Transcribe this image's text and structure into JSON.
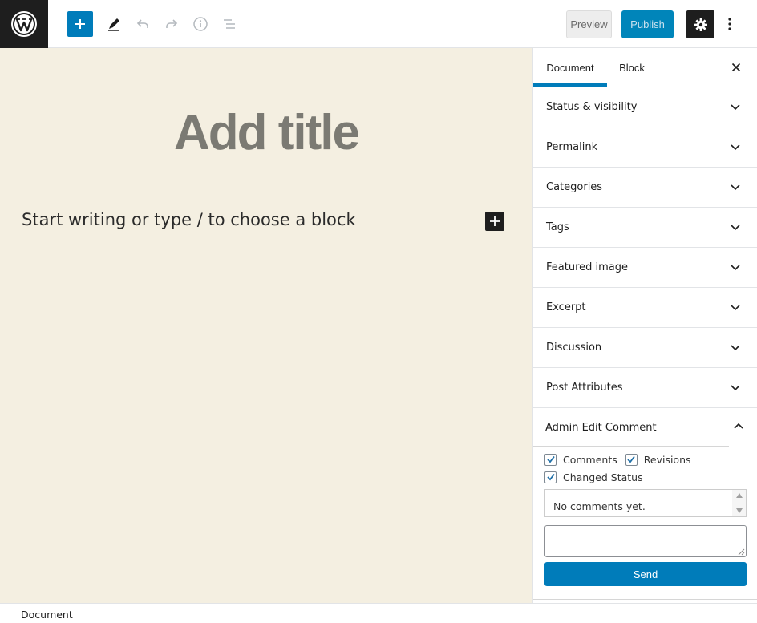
{
  "toolbar": {
    "preview_label": "Preview",
    "publish_label": "Publish",
    "accent_color": "#007cba"
  },
  "editor": {
    "title_placeholder": "Add title",
    "block_placeholder": "Start writing or type / to choose a block",
    "background_color": "#f4efe1"
  },
  "sidebar": {
    "tabs": [
      {
        "label": "Document",
        "active": true
      },
      {
        "label": "Block",
        "active": false
      }
    ],
    "panels": [
      {
        "label": "Status & visibility"
      },
      {
        "label": "Permalink"
      },
      {
        "label": "Categories"
      },
      {
        "label": "Tags"
      },
      {
        "label": "Featured image"
      },
      {
        "label": "Excerpt"
      },
      {
        "label": "Discussion"
      },
      {
        "label": "Post Attributes"
      }
    ],
    "admin_comment": {
      "title": "Admin Edit Comment",
      "expanded": true,
      "checkboxes": [
        {
          "label": "Comments",
          "checked": true
        },
        {
          "label": "Revisions",
          "checked": true
        },
        {
          "label": "Changed Status",
          "checked": true
        }
      ],
      "empty_text": "No comments yet.",
      "send_label": "Send"
    }
  },
  "footer": {
    "breadcrumb": "Document"
  }
}
